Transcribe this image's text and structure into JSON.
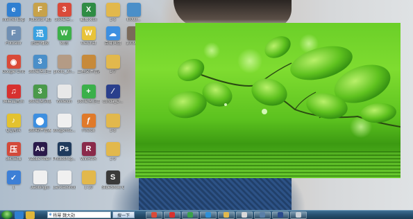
{
  "desktop": {
    "icons": [
      {
        "label": "Internet Explorer",
        "icon": "internet-explorer-icon",
        "color": "#2f7fd1",
        "glyph": "e"
      },
      {
        "label": "Fotosilor 截图程序...",
        "icon": "image-app-icon",
        "color": "#c7a24a",
        "glyph": "F"
      },
      {
        "label": "360安全...",
        "icon": "image-app-icon",
        "color": "#d94a3a",
        "glyph": "3"
      },
      {
        "label": "截图.xlsx",
        "icon": "excel-file-icon",
        "color": "#2f8c44",
        "glyph": "X"
      },
      {
        "label": "1-6",
        "icon": "folder-icon",
        "color": "#e2b84c",
        "glyph": ""
      },
      {
        "label": "I0098...",
        "icon": "image-file-icon",
        "color": "#4a8fc9",
        "glyph": ""
      },
      {
        "label": "Fotosilor",
        "icon": "image-app-icon",
        "color": "#6f8fb3",
        "glyph": "F"
      },
      {
        "label": "迅雷/播放",
        "icon": "app-icon",
        "color": "#3aa1e0",
        "glyph": "迅"
      },
      {
        "label": "微信",
        "icon": "wechat-icon",
        "color": "#3db04a",
        "glyph": "W"
      },
      {
        "label": "WeChat",
        "icon": "wechat-icon",
        "color": "#e8c33a",
        "glyph": "W"
      },
      {
        "label": "百度网盘",
        "icon": "cloud-drive-icon",
        "color": "#3d8fe0",
        "glyph": "☁"
      },
      {
        "label": "10098...",
        "icon": "image-file-icon",
        "color": "#7a6a5a",
        "glyph": ""
      },
      {
        "label": "Google Chrome",
        "icon": "chrome-icon",
        "color": "#d94a38",
        "glyph": "◉"
      },
      {
        "label": "360安全卫士",
        "icon": "app-icon",
        "color": "#4a8fc9",
        "glyph": "3"
      },
      {
        "label": "photo_20...",
        "icon": "image-file-icon",
        "color": "#b49b85",
        "glyph": ""
      },
      {
        "label": "工程文件管理",
        "icon": "app-icon",
        "color": "#c78a3a",
        "glyph": ""
      },
      {
        "label": "1-7",
        "icon": "folder-icon",
        "color": "#e2b84c",
        "glyph": ""
      },
      {
        "label": "网易云音乐",
        "icon": "netease-music-icon",
        "color": "#d7312f",
        "glyph": "♫"
      },
      {
        "label": "360安全浏览器",
        "icon": "app-icon",
        "color": "#4a9a4a",
        "glyph": "3"
      },
      {
        "label": "Wxfetch",
        "icon": "document-icon",
        "color": "#e8e8e8",
        "glyph": ""
      },
      {
        "label": "360安全卫士",
        "icon": "app-icon",
        "color": "#3bb04a",
        "glyph": "+"
      },
      {
        "label": "conda_D...",
        "icon": "app-icon",
        "color": "#2a3f8c",
        "glyph": "∕"
      },
      {
        "label": "QQ音乐",
        "icon": "qq-music-icon",
        "color": "#e3c22f",
        "glyph": "♪"
      },
      {
        "label": "360软件管家",
        "icon": "app-icon",
        "color": "#3d8fe0",
        "glyph": "⬤"
      },
      {
        "label": "wxsgxmsc...",
        "icon": "document-icon",
        "color": "#f0f0f0",
        "glyph": ""
      },
      {
        "label": "Firefox",
        "icon": "firefox-icon",
        "color": "#e07a2a",
        "glyph": "ƒ"
      },
      {
        "label": "1-8",
        "icon": "folder-icon",
        "color": "#e2b84c",
        "glyph": ""
      },
      {
        "label": "360压缩",
        "icon": "app-icon",
        "color": "#d34a3a",
        "glyph": "压"
      },
      {
        "label": "Adobe After Effects CC...",
        "icon": "after-effects-icon",
        "color": "#2a1a4a",
        "glyph": "Ae"
      },
      {
        "label": "Photoshop...",
        "icon": "photoshop-icon",
        "color": "#1f3a5c",
        "glyph": "Ps"
      },
      {
        "label": "WinRAR",
        "icon": "winrar-icon",
        "color": "#8a2a4a",
        "glyph": "R"
      },
      {
        "label": "1-9",
        "icon": "folder-icon",
        "color": "#e2b84c",
        "glyph": ""
      },
      {
        "label": "1",
        "icon": "app-icon",
        "color": "#3d7fd6",
        "glyph": "✓"
      },
      {
        "label": "Jiaobingtu",
        "icon": "document-icon",
        "color": "#f0f0f0",
        "glyph": ""
      },
      {
        "label": "Lanxiaoshou",
        "icon": "document-icon",
        "color": "#f0f0f0",
        "glyph": ""
      },
      {
        "label": "1-10",
        "icon": "folder-icon",
        "color": "#e2b84c",
        "glyph": ""
      },
      {
        "label": "SlideShow Creator",
        "icon": "app-icon",
        "color": "#3a3a3a",
        "glyph": "S"
      }
    ]
  },
  "taskbar": {
    "search_text": "杨幂 魏大勋",
    "search_button": "搜一下",
    "start_icon": "windows-start-icon",
    "quick_colors": [
      "#2f7fd1",
      "#e0b63a"
    ],
    "pinned": [
      {
        "icon": "chrome-icon",
        "color": "#d94a38"
      },
      {
        "icon": "netease-music-icon",
        "color": "#d7312f"
      },
      {
        "icon": "360-browser-icon",
        "color": "#3aa14a"
      },
      {
        "icon": "qq-icon",
        "color": "#2f8fd6"
      },
      {
        "icon": "file-manager-icon",
        "color": "#e2b84c"
      },
      {
        "icon": "document-icon",
        "color": "#d8d8d8"
      },
      {
        "icon": "app-icon",
        "color": "#5a7fa8"
      },
      {
        "icon": "pen-tool-icon",
        "color": "#2a4a8c"
      },
      {
        "icon": "image-viewer-icon",
        "color": "#c8cfd6"
      }
    ]
  },
  "viewer": {
    "image_subject": "green-leaves-wallpaper-image"
  }
}
